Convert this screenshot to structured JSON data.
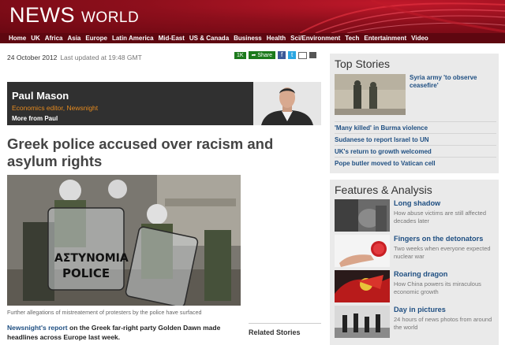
{
  "brand": {
    "news": "NEWS",
    "section": "WORLD"
  },
  "nav": [
    "Home",
    "UK",
    "Africa",
    "Asia",
    "Europe",
    "Latin America",
    "Mid-East",
    "US & Canada",
    "Business",
    "Health",
    "Sci/Environment",
    "Tech",
    "Entertainment",
    "Video"
  ],
  "article": {
    "date": "24 October 2012",
    "updated": "Last updated at 19:48 GMT",
    "share_count": "1K",
    "share_label": "Share",
    "author_name": "Paul Mason",
    "author_role": "Economics editor, Newsnight",
    "author_more": "More from Paul",
    "headline": "Greek police accused over racism and asylum rights",
    "image_text_1": "ΑΣΤΥΝΟΜΙΑ",
    "image_text_2": "POLICE",
    "caption": "Further allegations of mistreatement of protesters by the police have surfaced",
    "body_link": "Newsnight's report",
    "body_text": " on the Greek far-right party Golden Dawn made headlines across Europe last week.",
    "related": "Related Stories"
  },
  "top_stories": {
    "title": "Top Stories",
    "lead": "Syria army 'to observe ceasefire'",
    "items": [
      "'Many killed' in Burma violence",
      "Sudanese to report Israel to UN",
      "UK's return to growth welcomed",
      "Pope butler moved to Vatican cell"
    ]
  },
  "features": {
    "title": "Features & Analysis",
    "items": [
      {
        "title": "Long shadow",
        "desc": "How abuse victims are still affected decades later"
      },
      {
        "title": "Fingers on the detonators",
        "desc": "Two weeks when everyone expected nuclear war"
      },
      {
        "title": "Roaring dragon",
        "desc": "How China powers its miraculous economic growth"
      },
      {
        "title": "Day in pictures",
        "desc": "24 hours of news photos from around the world"
      }
    ]
  },
  "colors": {
    "brand_red": "#a1111f",
    "link_blue": "#1f4f82",
    "author_role": "#e58a1f"
  }
}
